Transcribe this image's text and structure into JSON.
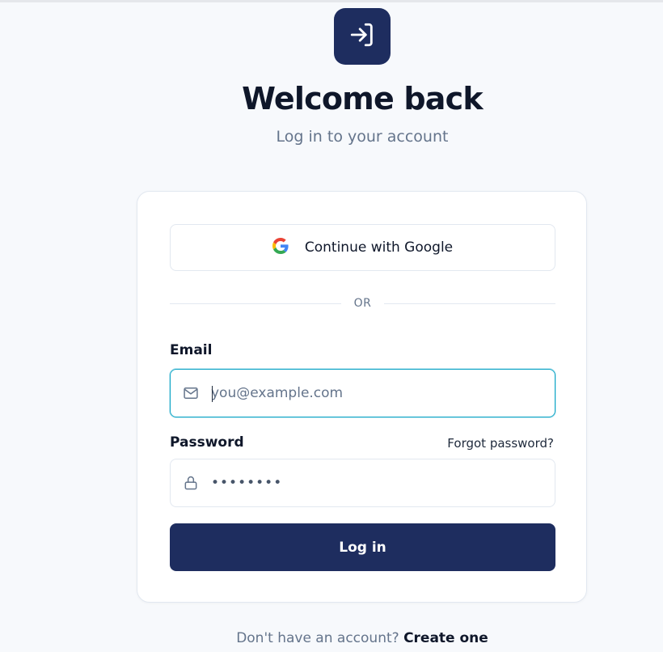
{
  "header": {
    "logo_icon": "sign-in-arrow-icon",
    "title": "Welcome back",
    "subtitle": "Log in to your account"
  },
  "card": {
    "google_button": {
      "label": "Continue with Google",
      "icon": "google-logo-icon"
    },
    "divider_text": "OR",
    "email": {
      "label": "Email",
      "placeholder": "you@example.com",
      "value": "",
      "icon": "mail-icon"
    },
    "password": {
      "label": "Password",
      "value": "••••••••",
      "icon": "lock-icon",
      "forgot_label": "Forgot password?"
    },
    "submit_label": "Log in"
  },
  "footer": {
    "prompt": "Don't have an account?",
    "link_label": "Create one"
  },
  "colors": {
    "brand": "#1e2d5f",
    "background": "#f7f9fc",
    "focus_ring": "#0ea5c6",
    "muted_text": "#64748b"
  }
}
